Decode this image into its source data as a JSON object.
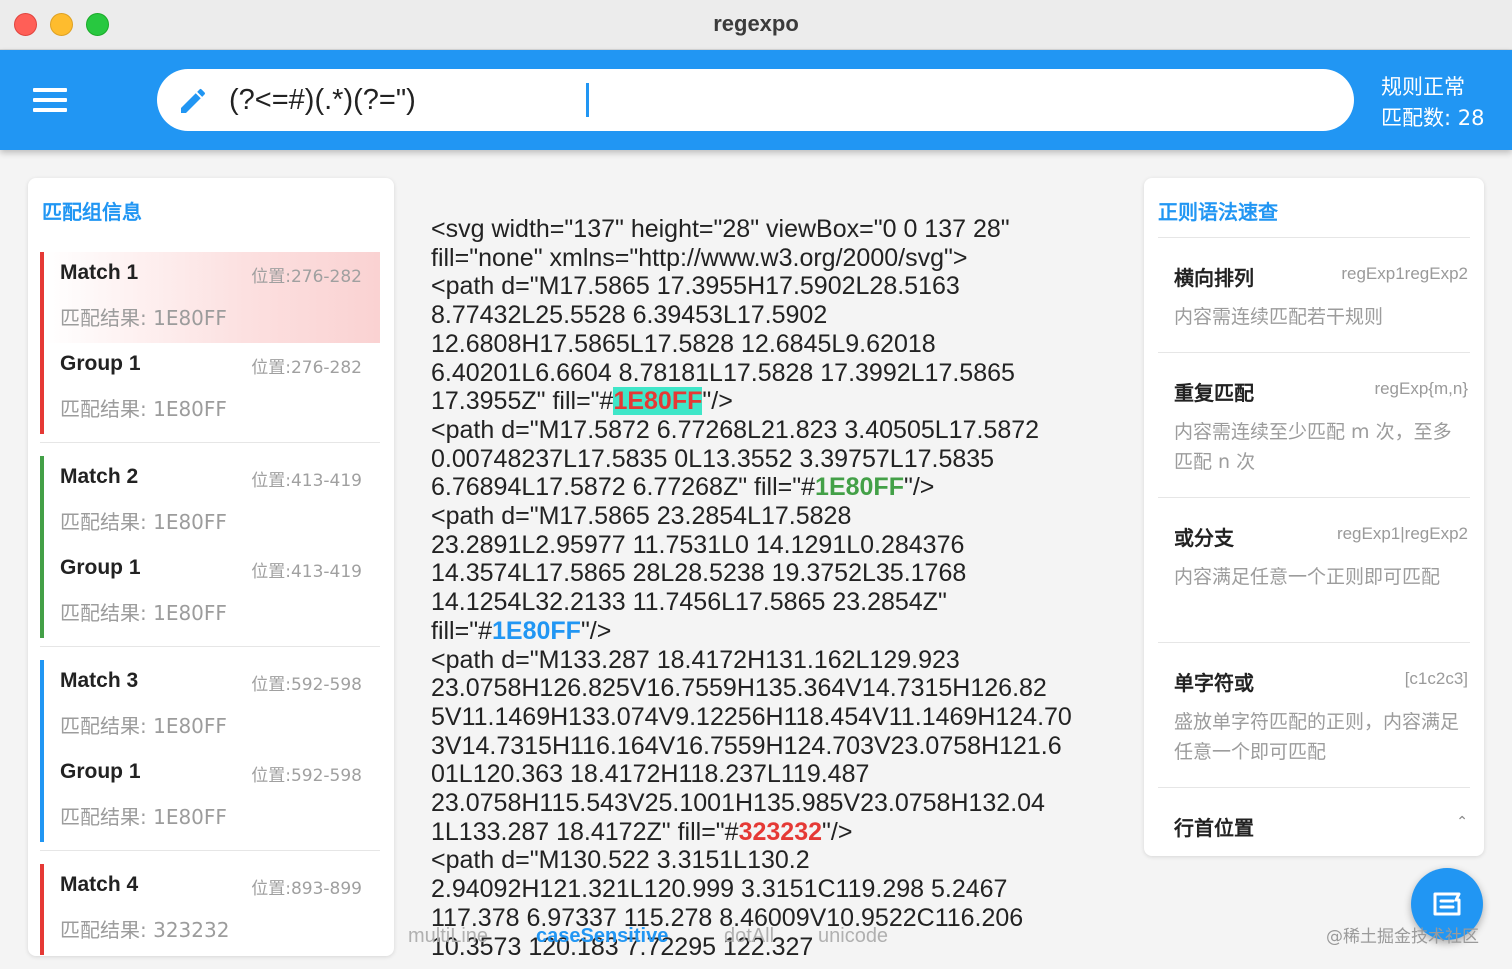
{
  "window": {
    "title": "regexpo"
  },
  "appbar": {
    "regex_value": "(?<=#)(.*)(?=\")",
    "status_rule": "规则正常",
    "status_count": "匹配数: 28"
  },
  "left_panel": {
    "title": "匹配组信息",
    "accent_colors": [
      "#e53935",
      "#43a047",
      "#2196f3",
      "#e53935"
    ],
    "matches": [
      {
        "title": "Match  1",
        "pos": "位置:276-282",
        "result": "匹配结果: 1E80FF",
        "group_title": "Group  1",
        "group_pos": "位置:276-282",
        "group_result": "匹配结果: 1E80FF"
      },
      {
        "title": "Match  2",
        "pos": "位置:413-419",
        "result": "匹配结果: 1E80FF",
        "group_title": "Group  1",
        "group_pos": "位置:413-419",
        "group_result": "匹配结果: 1E80FF"
      },
      {
        "title": "Match  3",
        "pos": "位置:592-598",
        "result": "匹配结果: 1E80FF",
        "group_title": "Group  1",
        "group_pos": "位置:592-598",
        "group_result": "匹配结果: 1E80FF"
      },
      {
        "title": "Match  4",
        "pos": "位置:893-899",
        "result": "匹配结果: 323232"
      }
    ]
  },
  "code": {
    "lines": [
      "<svg width=\"137\" height=\"28\" viewBox=\"0 0 137 28\"",
      "fill=\"none\" xmlns=\"http://www.w3.org/2000/svg\">",
      "<path d=\"M17.5865 17.3955H17.5902L28.5163",
      "8.77432L25.5528 6.39453L17.5902",
      "12.6808H17.5865L17.5828 12.6845L9.62018",
      "6.40201L6.6604 8.78181L17.5828 17.3992L17.5865"
    ],
    "hl_line_1": {
      "before": "17.3955Z\" fill=\"#",
      "match": "1E80FF",
      "after": "\"/>"
    },
    "lines_2": [
      "<path d=\"M17.5872 6.77268L21.823 3.40505L17.5872",
      "0.00748237L17.5835 0L13.3552 3.39757L17.5835"
    ],
    "hl_line_2": {
      "before": "6.76894L17.5872 6.77268Z\" fill=\"#",
      "match": "1E80FF",
      "after": "\"/>"
    },
    "lines_3": [
      "<path d=\"M17.5865 23.2854L17.5828",
      "23.2891L2.95977 11.7531L0 14.1291L0.284376",
      "14.3574L17.5865 28L28.5238 19.3752L35.1768",
      "14.1254L32.2133 11.7456L17.5865 23.2854Z\""
    ],
    "hl_line_3": {
      "before": "fill=\"#",
      "match": "1E80FF",
      "after": "\"/>"
    },
    "lines_4": [
      "<path d=\"M133.287 18.4172H131.162L129.923",
      "23.0758H126.825V16.7559H135.364V14.7315H126.82",
      "5V11.1469H133.074V9.12256H118.454V11.1469H124.70",
      "3V14.7315H116.164V16.7559H124.703V23.0758H121.6",
      "01L120.363 18.4172H118.237L119.487",
      "23.0758H115.543V25.1001H135.985V23.0758H132.04"
    ],
    "hl_line_4": {
      "before": "1L133.287 18.4172Z\" fill=\"#",
      "match": "323232",
      "after": "\"/>"
    },
    "lines_5": [
      "<path d=\"M130.522 3.3151L130.2",
      "2.94092H121.321L120.999 3.3151C119.298 5.2467",
      "117.378 6.97337 115.278 8.46009V10.9522C116.206",
      "10.3573 120.183 7.72295 122.327"
    ]
  },
  "flags": {
    "multiline": "multiLine",
    "case": "caseSensitive",
    "dotall": "dotAll",
    "unicode": "unicode"
  },
  "right_panel": {
    "title": "正则语法速查",
    "items": [
      {
        "title": "横向排列",
        "code": "regExp1regExp2",
        "desc": "内容需连续匹配若干规则"
      },
      {
        "title": "重复匹配",
        "code": "regExp{m,n}",
        "desc": "内容需连续至少匹配 m 次，至多匹配 n 次"
      },
      {
        "title": "或分支",
        "code": "regExp1|regExp2",
        "desc": "内容满足任意一个正则即可匹配"
      },
      {
        "title": "单字符或",
        "code": "[c1c2c3]",
        "desc": "盛放单字符匹配的正则，内容满足任意一个即可匹配"
      },
      {
        "title": "行首位置",
        "icon": "chevron-up-icon"
      }
    ]
  },
  "watermark": "@稀土掘金技术社区"
}
